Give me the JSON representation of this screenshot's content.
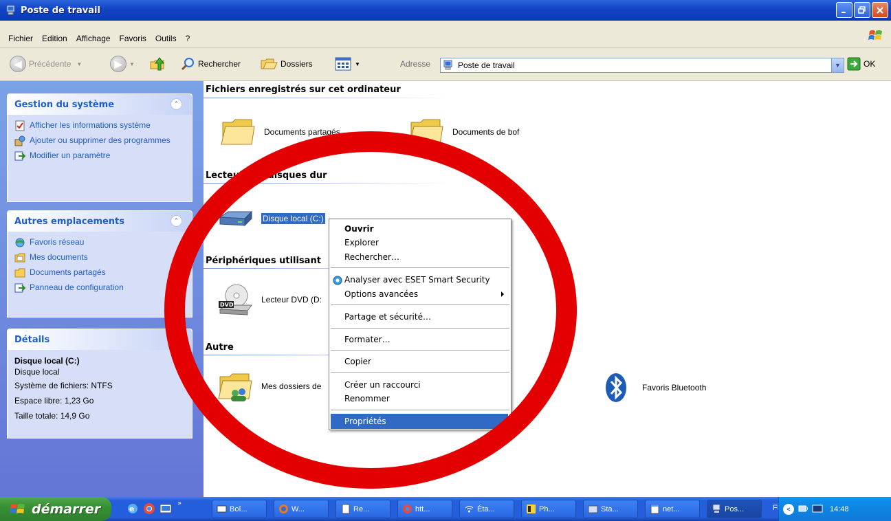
{
  "window": {
    "title": "Poste de travail"
  },
  "menubar": {
    "items": [
      "Fichier",
      "Edition",
      "Affichage",
      "Favoris",
      "Outils",
      "?"
    ]
  },
  "toolbar": {
    "back_label": "Précédente",
    "search_label": "Rechercher",
    "folders_label": "Dossiers",
    "address_label": "Adresse",
    "address_value": "Poste de travail",
    "go_label": "OK"
  },
  "leftpane": {
    "system_tasks": {
      "title": "Gestion du système",
      "links": [
        "Afficher les informations système",
        "Ajouter ou supprimer des programmes",
        "Modifier un paramètre"
      ]
    },
    "other_places": {
      "title": "Autres emplacements",
      "links": [
        "Favoris réseau",
        "Mes documents",
        "Documents partagés",
        "Panneau de configuration"
      ]
    },
    "details": {
      "title": "Détails",
      "name": "Disque local (C:)",
      "type": "Disque local",
      "filesystem": "Système de fichiers: NTFS",
      "free": "Espace libre: 1,23 Go",
      "total": "Taille totale: 14,9 Go"
    }
  },
  "main": {
    "sections": {
      "stored": "Fichiers enregistrés sur cet ordinateur",
      "hdd": "Lecteurs de disques dur",
      "removable": "Périphériques utilisant",
      "other": "Autre"
    },
    "items": {
      "shared_docs": "Documents partagés",
      "bof_docs": "Documents de bof",
      "local_disk": "Disque local (C:)",
      "dvd": "Lecteur DVD (D:",
      "my_folders": "Mes dossiers de",
      "bluetooth": "Favoris Bluetooth"
    }
  },
  "context_menu": {
    "items": [
      "Ouvrir",
      "Explorer",
      "Rechercher…",
      "Analyser avec ESET Smart Security",
      "Options avancées",
      "Partage et sécurité…",
      "Formater…",
      "Copier",
      "Créer un raccourci",
      "Renommer",
      "Propriétés"
    ]
  },
  "taskbar": {
    "start_label": "démarrer",
    "tasks": [
      "Boî...",
      "W...",
      "Re...",
      "htt...",
      "Éta...",
      "Ph...",
      "Sta...",
      "net...",
      "Pos..."
    ],
    "lang": "FR",
    "clock": "14:48"
  },
  "colors": {
    "titlebar": "#0b3bb8",
    "leftpane": "#6f8ee0",
    "highlight": "#316ac5",
    "annotation": "#e30000"
  }
}
